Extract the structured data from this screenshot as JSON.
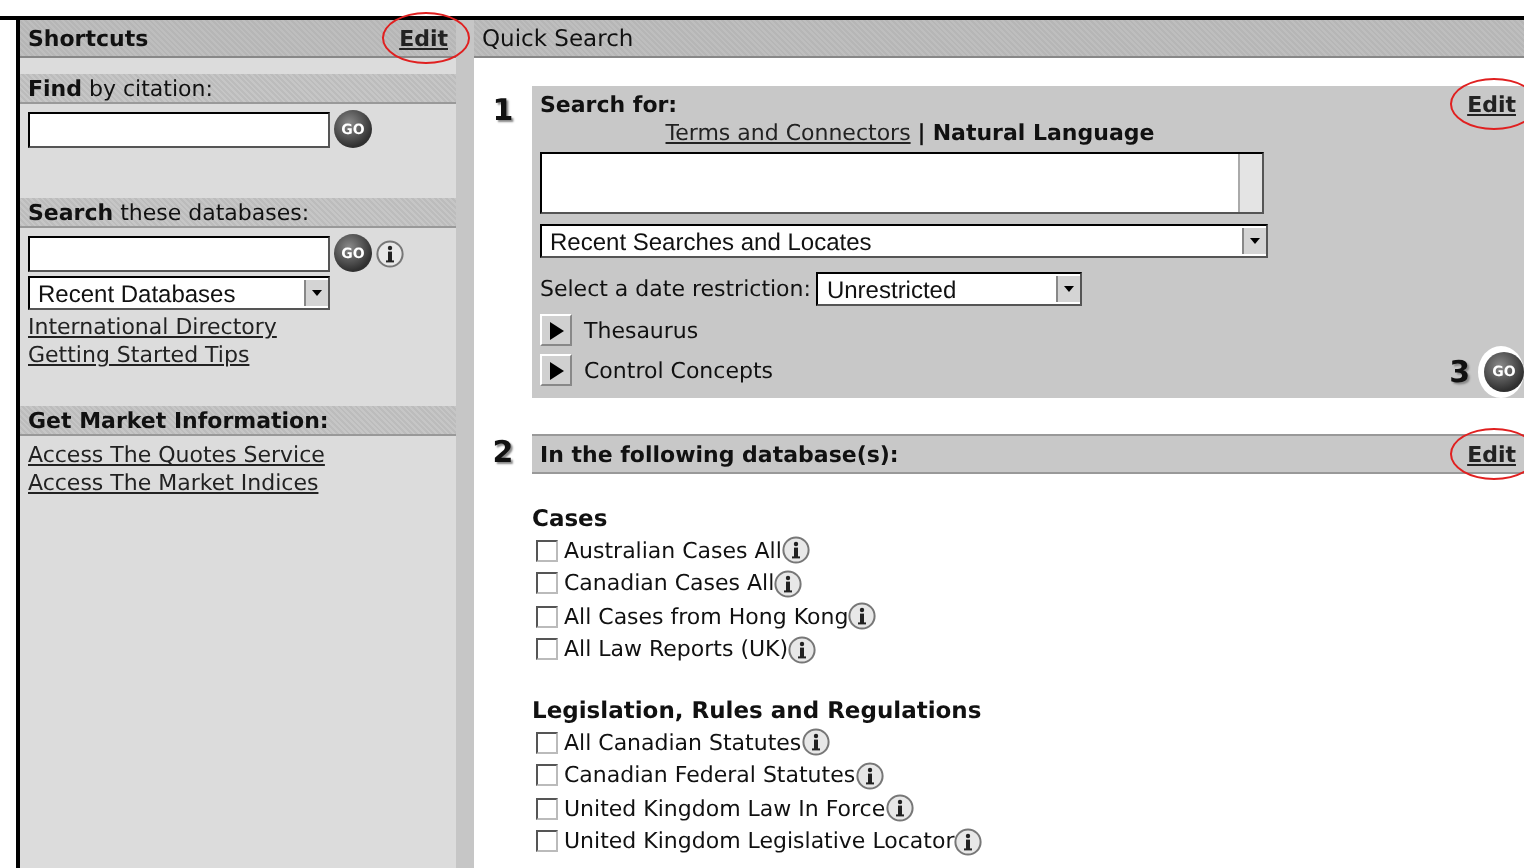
{
  "sidebar": {
    "title": "Shortcuts",
    "edit_link": {
      "label": "Edit",
      "circled": true
    },
    "sections": [
      {
        "heading": "**Find** by citation:",
        "field": true,
        "go": {
          "label": "GO",
          "info": false
        }
      },
      {
        "heading": "**Search** these databases:",
        "field": true,
        "go": {
          "label": "GO",
          "info": true
        },
        "select": "Recent Databases",
        "links": [
          "International Directory",
          "Getting Started Tips"
        ]
      },
      {
        "heading": "**Get Market Information:**",
        "links": [
          "Access The Quotes Service",
          "Access The Market Indices"
        ]
      }
    ]
  },
  "quick_search": {
    "title": "Quick Search",
    "step1": {
      "number": "1",
      "heading": "Search for:",
      "edit_link": {
        "label": "Edit",
        "circled": true
      },
      "modes": [
        {
          "label": "Terms and Connectors",
          "selected": false
        },
        {
          "label": "Natural Language",
          "selected": true
        }
      ],
      "separator": "|",
      "recent_select": "Recent Searches and Locates",
      "date_label": "Select a date restriction:",
      "date_select": "Unrestricted",
      "expanders": [
        {
          "label": "Thesaurus",
          "expanded": false
        },
        {
          "label": "Control Concepts",
          "expanded": false
        }
      ],
      "submit": {
        "number": "3",
        "label": "GO"
      }
    },
    "step2": {
      "number": "2",
      "heading": "In the following database(s):",
      "edit_link": {
        "label": "Edit",
        "circled": true
      },
      "groups": [
        {
          "heading": "Cases",
          "items": [
            {
              "label": "Australian Cases All",
              "checked": false
            },
            {
              "label": "Canadian Cases All",
              "checked": false
            },
            {
              "label": "All Cases from Hong Kong",
              "checked": false
            },
            {
              "label": "All Law Reports (UK)",
              "checked": false
            }
          ]
        },
        {
          "heading": "Legislation, Rules and Regulations",
          "items": [
            {
              "label": "All Canadian Statutes",
              "checked": false
            },
            {
              "label": "Canadian Federal Statutes",
              "checked": false
            },
            {
              "label": "United Kingdom Law In Force",
              "checked": false
            },
            {
              "label": "United Kingdom Legislative Locator",
              "checked": false
            }
          ]
        }
      ]
    }
  }
}
